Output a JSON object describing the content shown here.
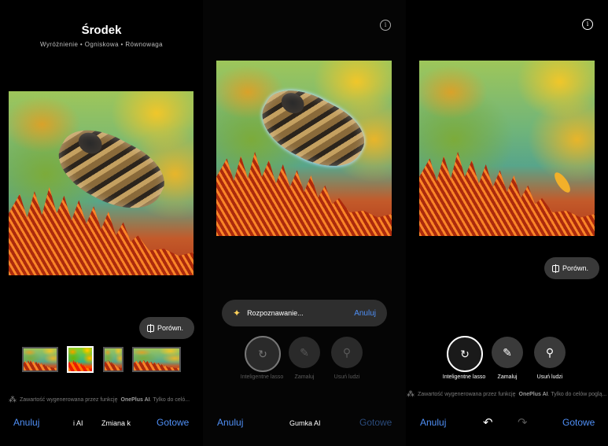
{
  "panel1": {
    "title": "Środek",
    "subtitle": "Wyróżnienie • Ogniskowa • Równowaga",
    "compare_label": "Porówn.",
    "disclaimer_prefix": "Zawartość wygenerowana przez funkcję",
    "disclaimer_brand": "OnePlus AI",
    "disclaimer_suffix": ". Tylko do celó...",
    "cancel": "Anuluj",
    "tab_ai": "i AI",
    "tab_change": "Zmiana k",
    "done": "Gotowe"
  },
  "panel2": {
    "recognizing": "Rozpoznawanie...",
    "cancel_recognize": "Anuluj",
    "tools": [
      {
        "label": "Inteligentne lasso",
        "icon": "smart-lasso-icon"
      },
      {
        "label": "Zamaluj",
        "icon": "paint-over-icon"
      },
      {
        "label": "Usuń ludzi",
        "icon": "remove-people-icon"
      }
    ],
    "cancel": "Anuluj",
    "title": "Gumka AI",
    "done": "Gotowe",
    "info": "i"
  },
  "panel3": {
    "compare_label": "Porówn.",
    "tools": [
      {
        "label": "Inteligentne lasso",
        "icon": "smart-lasso-icon"
      },
      {
        "label": "Zamaluj",
        "icon": "paint-over-icon"
      },
      {
        "label": "Usuń ludzi",
        "icon": "remove-people-icon"
      }
    ],
    "disclaimer_prefix": "Zawartość wygenerowana przez funkcję",
    "disclaimer_brand": "OnePlus AI",
    "disclaimer_suffix": ". Tylko do celów poglą...",
    "cancel": "Anuluj",
    "done": "Gotowe",
    "info": "i"
  },
  "colors": {
    "accent": "#4f8ff5",
    "background": "#000000",
    "pill": "#2e2e2e"
  }
}
